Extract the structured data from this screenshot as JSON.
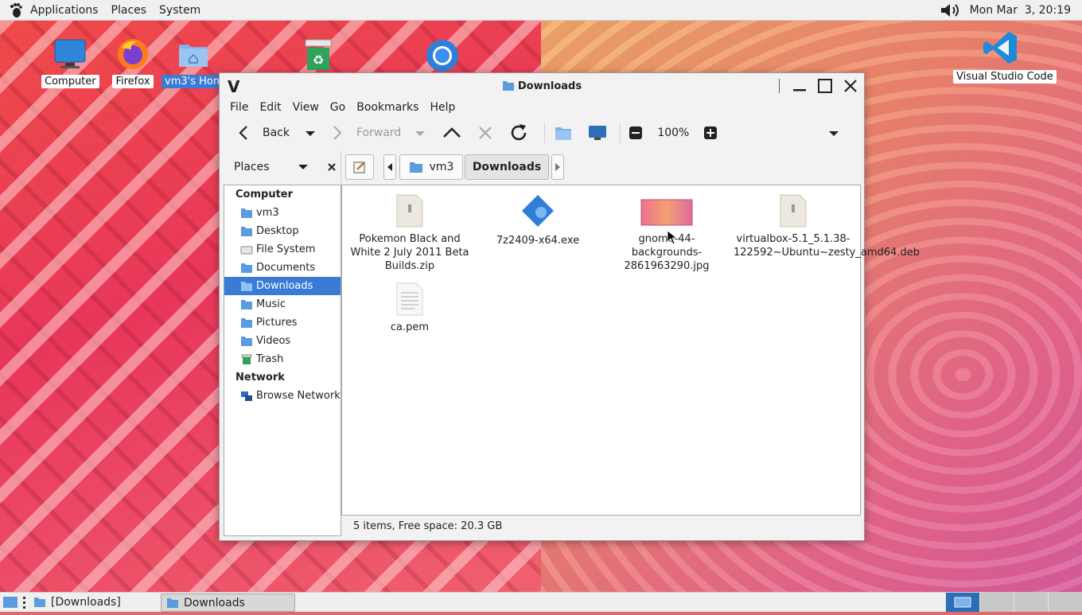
{
  "top_panel": {
    "menus": [
      "Applications",
      "Places",
      "System"
    ],
    "clock": "Mon Mar  3, 20:19",
    "icons": [
      "gnome-foot-icon",
      "volume-icon"
    ]
  },
  "desktop_icons": [
    {
      "label": "Computer",
      "icon": "computer-icon"
    },
    {
      "label": "Firefox",
      "icon": "firefox-icon"
    },
    {
      "label": "vm3's Hom",
      "icon": "home-folder-icon"
    },
    {
      "label": "",
      "icon": "trash-icon"
    },
    {
      "label": "",
      "icon": "chromium-icon"
    },
    {
      "label": "Visual Studio Code",
      "icon": "vscode-icon"
    }
  ],
  "window": {
    "title": "Downloads",
    "wm_left": "V",
    "menu": [
      "File",
      "Edit",
      "View",
      "Go",
      "Bookmarks",
      "Help"
    ],
    "toolbar": {
      "back": "Back",
      "forward": "Forward",
      "zoom": "100%"
    },
    "places_label": "Places",
    "path": [
      "vm3",
      "Downloads"
    ],
    "sidebar": {
      "sections": [
        {
          "header": "Computer",
          "items": [
            {
              "label": "vm3",
              "icon": "home-folder-icon"
            },
            {
              "label": "Desktop",
              "icon": "folder-icon"
            },
            {
              "label": "File System",
              "icon": "drive-icon"
            },
            {
              "label": "Documents",
              "icon": "folder-icon"
            },
            {
              "label": "Downloads",
              "icon": "download-folder-icon",
              "selected": true
            },
            {
              "label": "Music",
              "icon": "music-folder-icon"
            },
            {
              "label": "Pictures",
              "icon": "pictures-folder-icon"
            },
            {
              "label": "Videos",
              "icon": "videos-folder-icon"
            },
            {
              "label": "Trash",
              "icon": "trash-icon"
            }
          ]
        },
        {
          "header": "Network",
          "items": [
            {
              "label": "Browse Network",
              "icon": "network-icon"
            }
          ]
        }
      ]
    },
    "files": [
      {
        "name": "Pokemon Black and White 2 July 2011 Beta Builds.zip",
        "icon": "archive-icon"
      },
      {
        "name": "7z2409-x64.exe",
        "icon": "executable-icon"
      },
      {
        "name": "gnome-44-backgrounds-2861963290.jpg",
        "icon": "image-thumbnail-icon"
      },
      {
        "name": "virtualbox-5.1_5.1.38-122592~Ubuntu~zesty_amd64.deb",
        "icon": "package-icon"
      },
      {
        "name": "ca.pem",
        "icon": "text-file-icon"
      }
    ],
    "status": "5 items, Free space: 20.3 GB"
  },
  "bottom_panel": {
    "tasks": [
      "[Downloads]",
      "Downloads"
    ]
  },
  "colors": {
    "selection": "#3a7bd5",
    "folder": "#5b9be0"
  }
}
